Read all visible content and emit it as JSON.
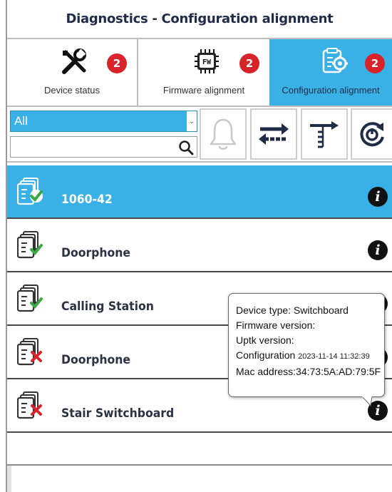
{
  "window": {
    "title": "Diagnostics - Configuration alignment"
  },
  "tabs": [
    {
      "label": "Device status",
      "badge": "2",
      "icon": "tools-icon"
    },
    {
      "label": "Firmware alignment",
      "badge": "2",
      "icon": "firmware-chip-icon",
      "chip_text": "FW"
    },
    {
      "label": "Configuration alignment",
      "badge": "2",
      "icon": "config-gear-doc-icon",
      "active": true
    }
  ],
  "toolbar": {
    "filter_value": "All",
    "search_value": "",
    "buttons": [
      "bell-icon",
      "exchange-arrows-icon",
      "list-arrow-icon",
      "refresh-power-icon"
    ]
  },
  "devices": [
    {
      "name": "1060-42",
      "status": "aligned",
      "selected": true
    },
    {
      "name": "Doorphone",
      "status": "aligned"
    },
    {
      "name": "Calling Station",
      "status": "aligned"
    },
    {
      "name": "Doorphone",
      "status": "not-aligned"
    },
    {
      "name": "Stair Switchboard",
      "status": "not-aligned"
    }
  ],
  "info_glyph": "i",
  "tooltip": {
    "device_type": "Device type: Switchboard",
    "firmware_version": "Firmware version:",
    "uptk_version": "Uptk version:",
    "configuration_label": "Configuration",
    "configuration_value": "2023-11-14 11:32:39",
    "mac_address": "Mac address:34:73:5A:AD:79:5F"
  },
  "colors": {
    "accent": "#39b1e6",
    "badge": "#d8232a",
    "ok_check": "#39a845",
    "error_cross": "#d8232a"
  }
}
